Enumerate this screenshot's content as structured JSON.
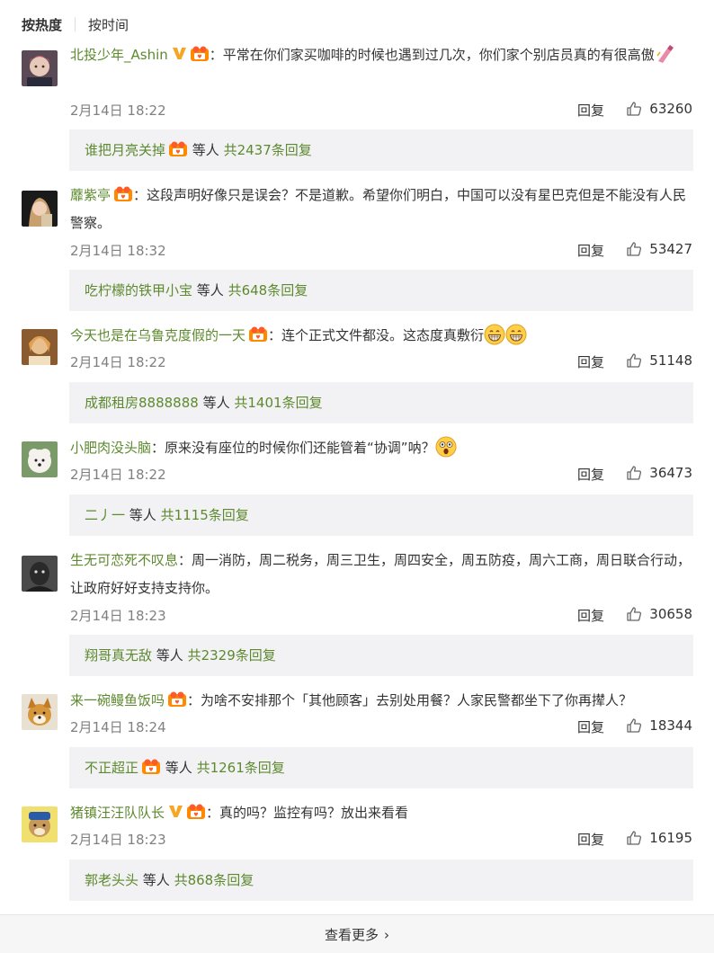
{
  "sort": {
    "hot": "按热度",
    "time": "按时间"
  },
  "common": {
    "reply": "回复",
    "etc": "等人",
    "colon": "："
  },
  "comments": [
    {
      "user": "北投少年_Ashin",
      "text": "平常在你们家买咖啡的时候也遇到过几次，你们家个别店员真的有很高傲",
      "time": "2月14日 18:22",
      "likes": "63260",
      "reply_user": "谁把月亮关掉",
      "reply_count": "共2437条回复"
    },
    {
      "user": "蘼紫亭",
      "text": "这段声明好像只是误会？不是道歉。希望你们明白，中国可以没有星巴克但是不能没有人民警察。",
      "time": "2月14日 18:32",
      "likes": "53427",
      "reply_user": "吃柠檬的铁甲小宝",
      "reply_count": "共648条回复"
    },
    {
      "user": "今天也是在乌鲁克度假的一天",
      "text": "连个正式文件都没。这态度真敷衍",
      "time": "2月14日 18:22",
      "likes": "51148",
      "reply_user": "成都租房8888888",
      "reply_count": "共1401条回复"
    },
    {
      "user": "小肥肉没头脑",
      "text": "原来没有座位的时候你们还能管着“协调”呐？",
      "time": "2月14日 18:22",
      "likes": "36473",
      "reply_user": "二丿一",
      "reply_count": "共1115条回复"
    },
    {
      "user": "生无可恋死不叹息",
      "text": "周一消防，周二税务，周三卫生，周四安全，周五防疫，周六工商，周日联合行动，让政府好好支持支持你。",
      "time": "2月14日 18:23",
      "likes": "30658",
      "reply_user": "翔哥真无敌",
      "reply_count": "共2329条回复"
    },
    {
      "user": "来一碗鳗鱼饭吗",
      "text": "为啥不安排那个「其他顾客」去别处用餐？人家民警都坐下了你再撵人？",
      "time": "2月14日 18:24",
      "likes": "18344",
      "reply_user": "不正超正",
      "reply_count": "共1261条回复"
    },
    {
      "user": "猪镇汪汪队队长",
      "text": "真的吗？监控有吗？放出来看看",
      "time": "2月14日 18:23",
      "likes": "16195",
      "reply_user": "郭老头头",
      "reply_count": "共868条回复"
    }
  ],
  "footer": {
    "more": "查看更多"
  },
  "icons": {
    "vip": "vip-v-icon",
    "member": "member-badge-icon",
    "like": "thumbs-up-icon",
    "more": "chevron-right-icon"
  },
  "colors": {
    "username": "#5d8a2e",
    "meta": "#808080",
    "reply_bg": "#f2f2f5"
  }
}
